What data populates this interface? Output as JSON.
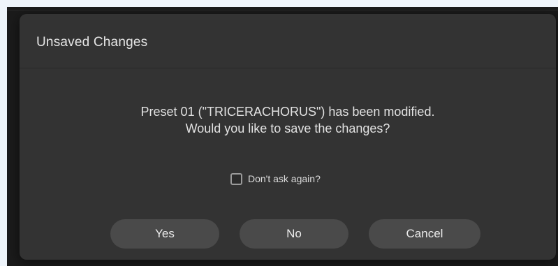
{
  "dialog": {
    "title": "Unsaved Changes",
    "message_line1": "Preset 01 (\"TRICERACHORUS\") has been modified.",
    "message_line2": "Would you like to save the changes?",
    "dont_ask_label": "Don't ask again?",
    "dont_ask_checked": false,
    "buttons": {
      "yes": "Yes",
      "no": "No",
      "cancel": "Cancel"
    }
  },
  "colors": {
    "dialog_bg": "#333333",
    "button_bg": "#4a4a4a",
    "backdrop": "#1b1b1b"
  }
}
